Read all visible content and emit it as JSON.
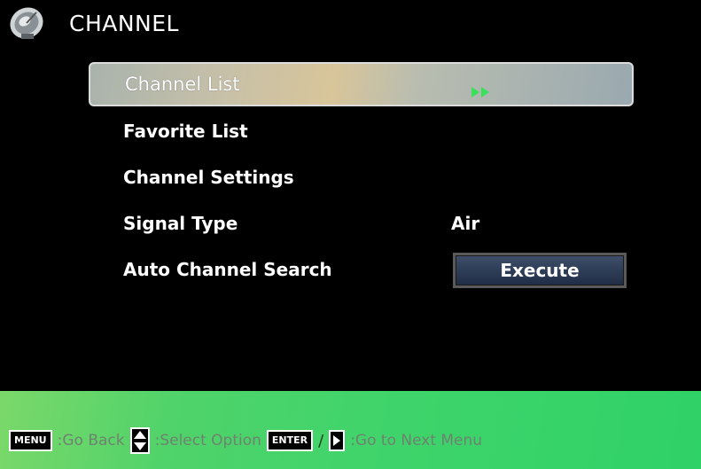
{
  "header": {
    "title": "CHANNEL",
    "icon": "satellite-dish-icon"
  },
  "menu": {
    "items": [
      {
        "label": "Channel List",
        "value": "",
        "selected": true,
        "icon": "double-arrow-right-icon"
      },
      {
        "label": "Favorite List",
        "value": "",
        "selected": false
      },
      {
        "label": "Channel Settings",
        "value": "",
        "selected": false
      },
      {
        "label": "Signal Type",
        "value": "Air",
        "selected": false
      },
      {
        "label": "Auto Channel Search",
        "value": "",
        "button": "Execute",
        "selected": false
      }
    ]
  },
  "footer": {
    "menu_key": "MENU",
    "menu_hint": ":Go Back",
    "select_hint": ":Select Option",
    "enter_key": "ENTER",
    "slash": "/",
    "next_hint": ":Go to Next Menu"
  },
  "colors": {
    "background": "#000000",
    "footer_green": "#3fd46b",
    "selected_row": "#c7c0a8",
    "button_blue": "#2a3a56",
    "arrow_green": "#3adf5a"
  }
}
